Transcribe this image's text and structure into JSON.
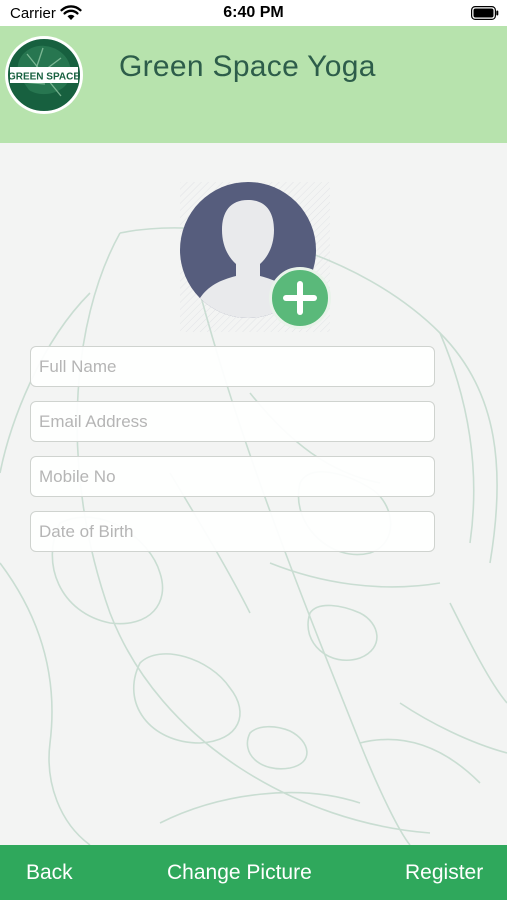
{
  "status_bar": {
    "carrier": "Carrier",
    "time": "6:40 PM",
    "icons": [
      "wifi-icon",
      "battery-icon"
    ]
  },
  "header": {
    "logo_text": "GREEN SPACE",
    "title": "Green Space Yoga"
  },
  "avatar": {
    "icon": "person-silhouette-icon",
    "add_icon": "plus-icon"
  },
  "form": {
    "full_name": {
      "placeholder": "Full Name",
      "value": ""
    },
    "email": {
      "placeholder": "Email Address",
      "value": ""
    },
    "mobile": {
      "placeholder": "Mobile No",
      "value": ""
    },
    "dob": {
      "placeholder": "Date of Birth",
      "value": ""
    }
  },
  "footer": {
    "back_label": "Back",
    "change_picture_label": "Change Picture",
    "register_label": "Register"
  },
  "colors": {
    "header_bg": "#b7e3ad",
    "title_text": "#2d5d4a",
    "footer_bg": "#2fa85c",
    "add_button": "#5ab97a",
    "avatar_bg": "#565d7d",
    "logo_green": "#17603f"
  }
}
